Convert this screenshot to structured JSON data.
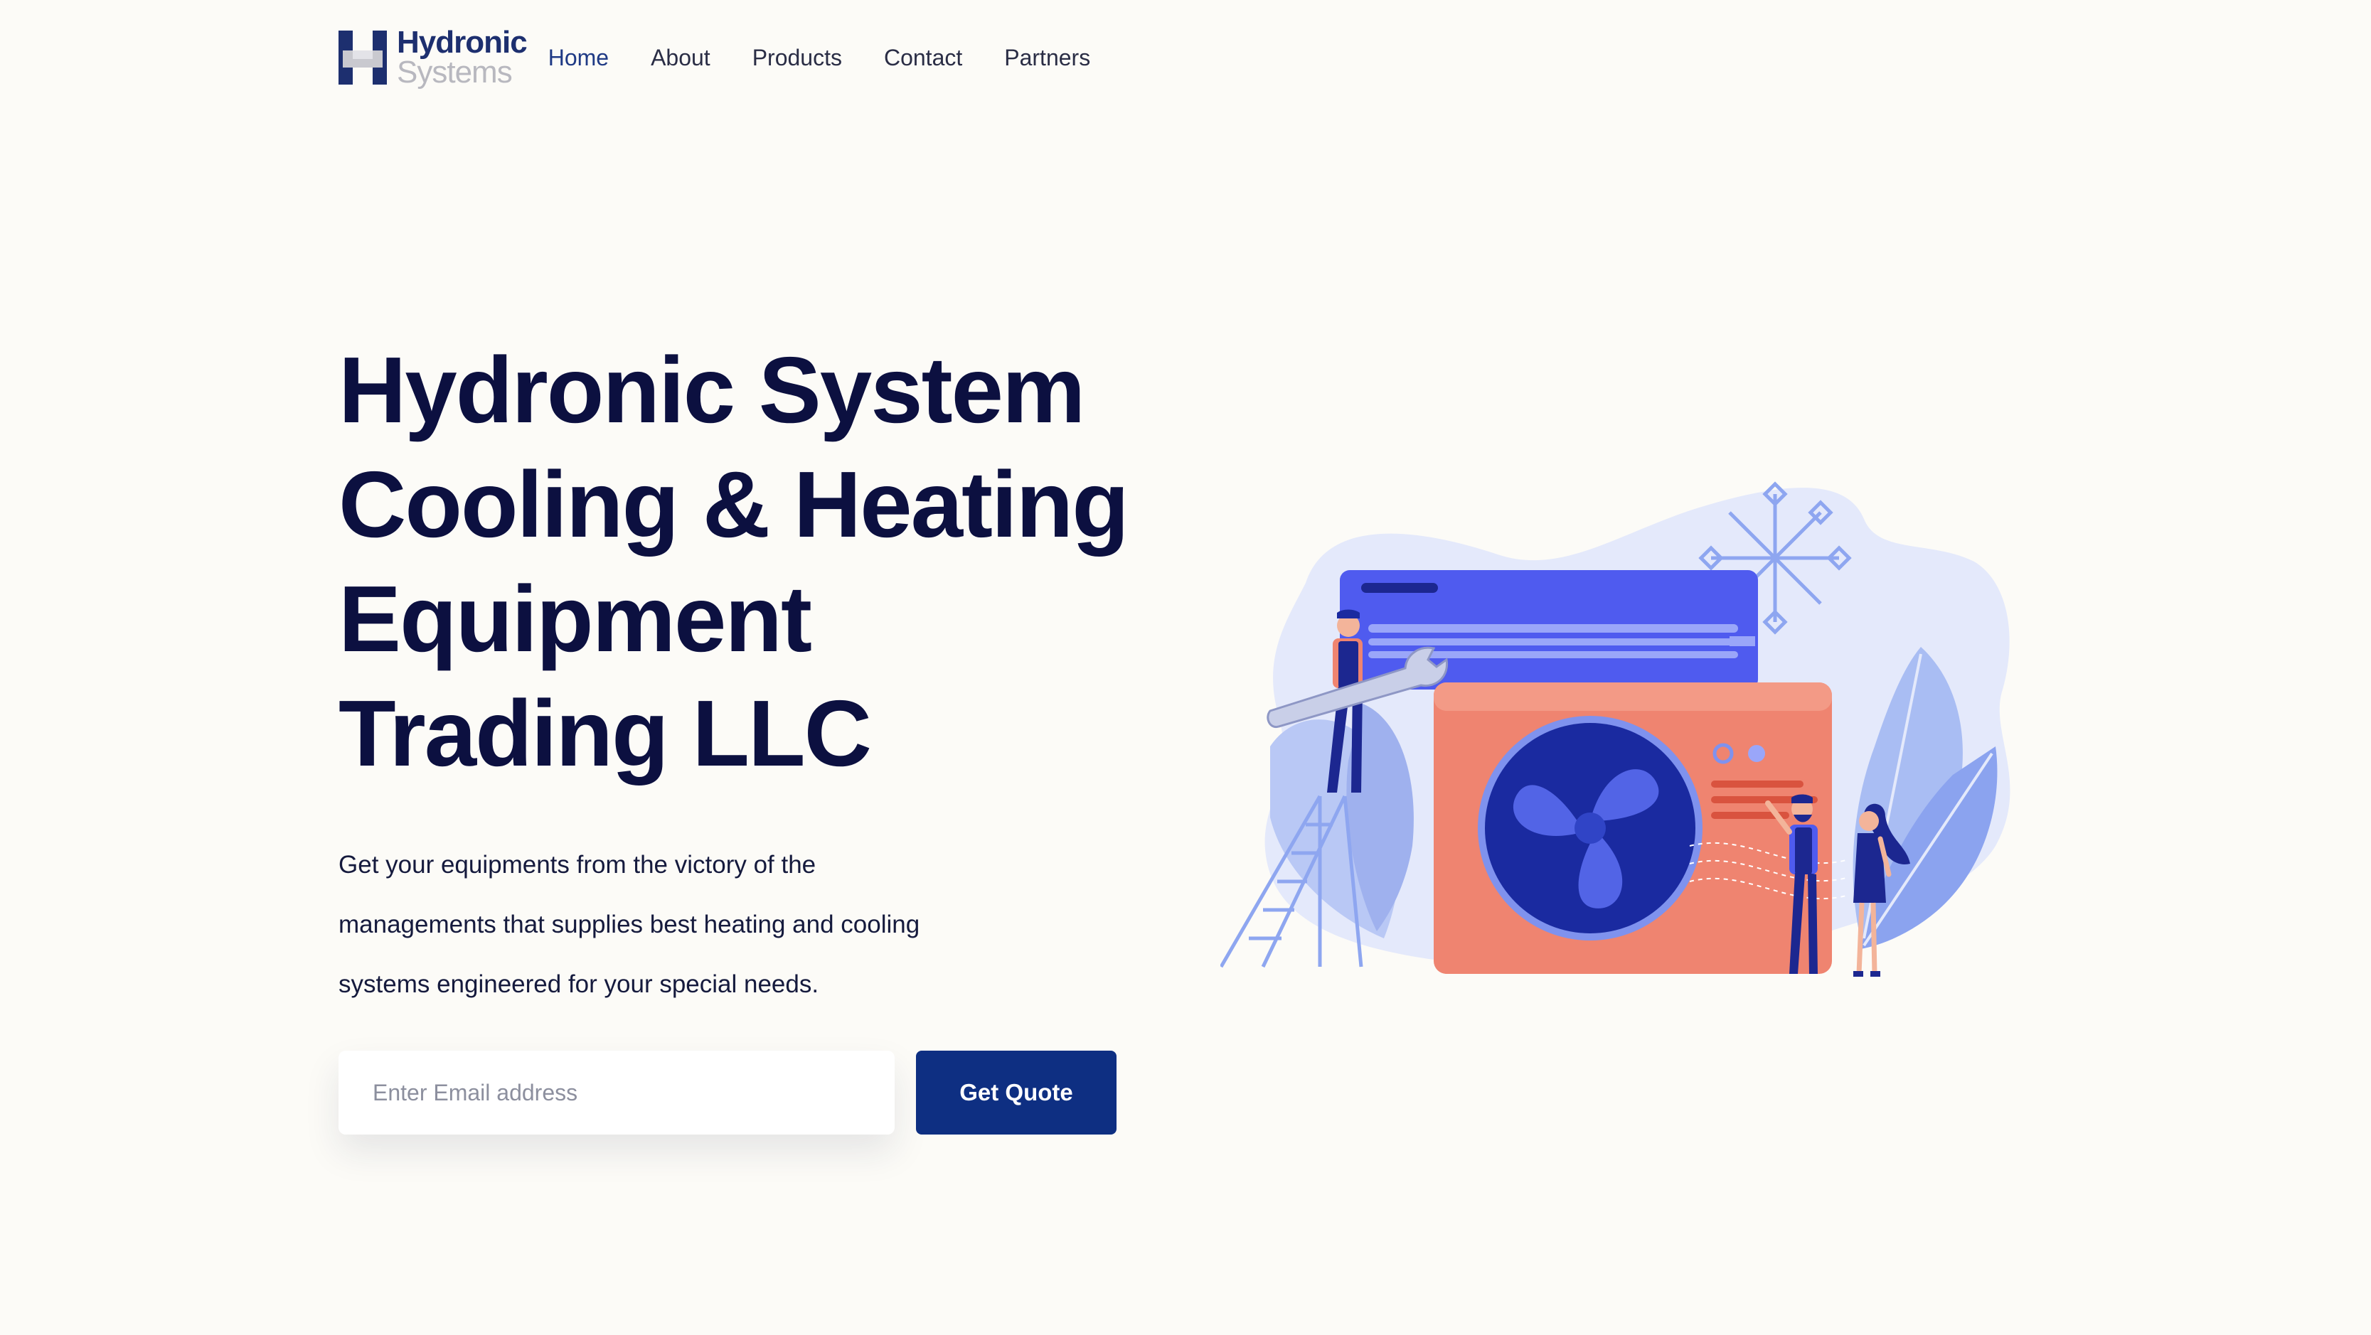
{
  "brand": {
    "name_line1": "Hydronic",
    "name_line2": "Systems",
    "icon": "h-logo-icon"
  },
  "nav": {
    "items": [
      {
        "label": "Home",
        "active": true
      },
      {
        "label": "About",
        "active": false
      },
      {
        "label": "Products",
        "active": false
      },
      {
        "label": "Contact",
        "active": false
      },
      {
        "label": "Partners",
        "active": false
      }
    ]
  },
  "hero": {
    "title_lines": [
      "Hydronic System",
      "Cooling & Heating",
      "Equipment",
      "Trading LLC"
    ],
    "description_lines": [
      "Get your equipments from the victory of the",
      "managements that supplies best heating and cooling",
      "systems engineered for your special needs."
    ],
    "email_placeholder": "Enter Email address",
    "email_value": "",
    "button_label": "Get Quote"
  },
  "illustration": {
    "subject": "hvac-technicians-illustration"
  },
  "colors": {
    "background": "#fcfbf7",
    "primary": "#0e2f82",
    "heading": "#0c1040",
    "nav_active": "#1f3a85",
    "unit_coral": "#ef8470",
    "unit_blue": "#4f5bef",
    "fan_dark": "#1a2aa0",
    "leaf_light": "#a9bdf3"
  }
}
